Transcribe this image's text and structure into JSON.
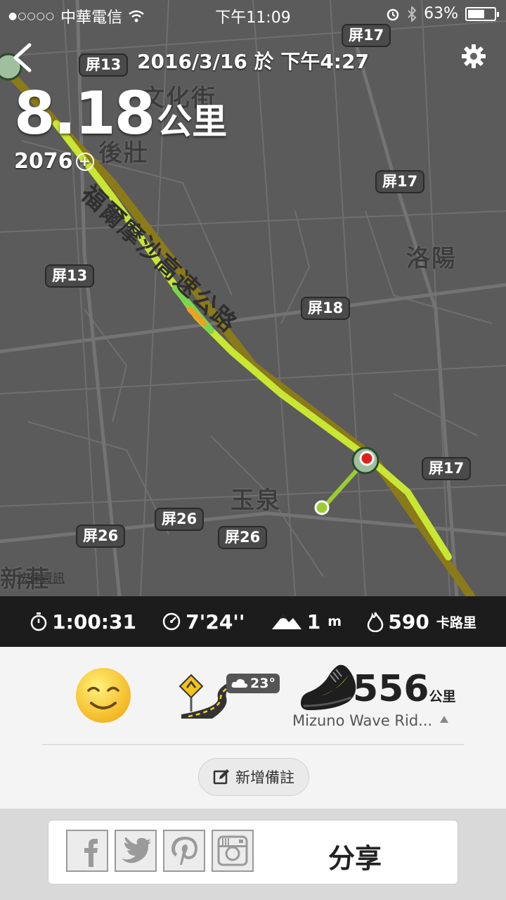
{
  "status_bar": {
    "carrier": "中華電信",
    "time": "下午11:09",
    "battery": "63%",
    "battery_level": 0.63
  },
  "header": {
    "date": "2016/3/16 於 下午4:27",
    "back_icon": "chevron-left-icon",
    "settings_icon": "gear-icon"
  },
  "run": {
    "distance_value": "8.18",
    "distance_unit": "公里",
    "nikefuel": "2076"
  },
  "map": {
    "road_labels": [
      "屏17",
      "屏13",
      "屏17",
      "屏13",
      "屏18",
      "屏17",
      "屏26",
      "屏26",
      "屏26"
    ],
    "place_labels": [
      "文化街",
      "後壯",
      "洛陽",
      "玉泉",
      "新莊"
    ],
    "road_name": "福爾摩沙高速公路",
    "legal": "法律資訊",
    "route_color": "#c8e632",
    "start_color": "#9acd32",
    "end_color": "#e02020"
  },
  "stats": {
    "duration": "1:00:31",
    "pace": "7'24''",
    "elevation": "1",
    "elevation_unit": "m",
    "calories": "590",
    "calories_unit": "卡路里"
  },
  "summary": {
    "mood_icon": "smiley-icon",
    "terrain_icon": "road-icon",
    "temperature": "23°",
    "shoe_distance": "556",
    "shoe_unit": "公里",
    "shoe_name": "Mizuno Wave Rid...",
    "add_note": "新增備註"
  },
  "share": {
    "label": "分享",
    "buttons": [
      "facebook-icon",
      "twitter-icon",
      "pinterest-icon",
      "instagram-icon"
    ]
  }
}
